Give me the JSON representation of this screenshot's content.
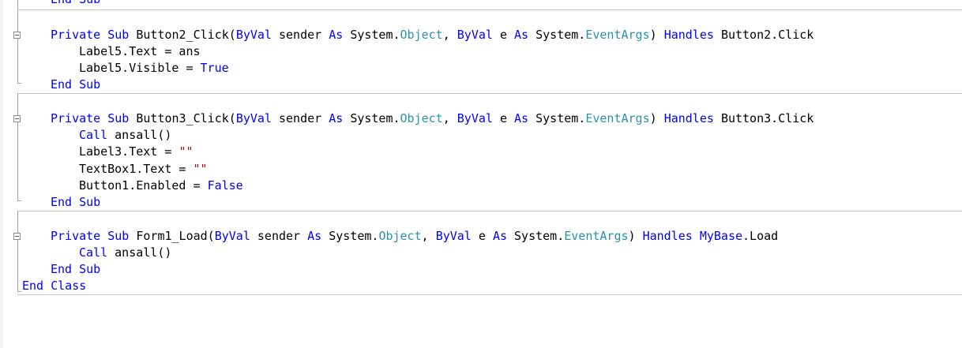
{
  "editor": {
    "language": "Visual Basic",
    "colors": {
      "keyword": "#0000ff",
      "type": "#2b91af",
      "string": "#a31515",
      "text": "#000000"
    },
    "tokens": {
      "private": "Private",
      "sub": "Sub",
      "byval": "ByVal",
      "as": "As",
      "handles": "Handles",
      "end": "End",
      "call": "Call",
      "true": "True",
      "false": "False",
      "class": "Class",
      "object": "Object",
      "eventargs": "EventArgs",
      "mybase": "MyBase",
      "empty_string": "\"\""
    },
    "text": {
      "system_dot": "System.",
      "sender": " sender ",
      "e": " e ",
      "comma_space": ", ",
      "close_paren": ") ",
      "space": " ",
      "label5_text": "Label5.Text = ans",
      "label5_visible": "Label5.Visible = ",
      "ansall_call": "ansall()",
      "label3_text": "Label3.Text = ",
      "textbox1_text": "TextBox1.Text = ",
      "button1_enabled": "Button1.Enabled = ",
      "b2_name": "Button2_Click(",
      "b2_event": "Button2.Click",
      "b3_name": "Button3_Click(",
      "b3_event": "Button3.Click",
      "form_name": "Form1_Load(",
      "form_event": ".Load"
    }
  }
}
